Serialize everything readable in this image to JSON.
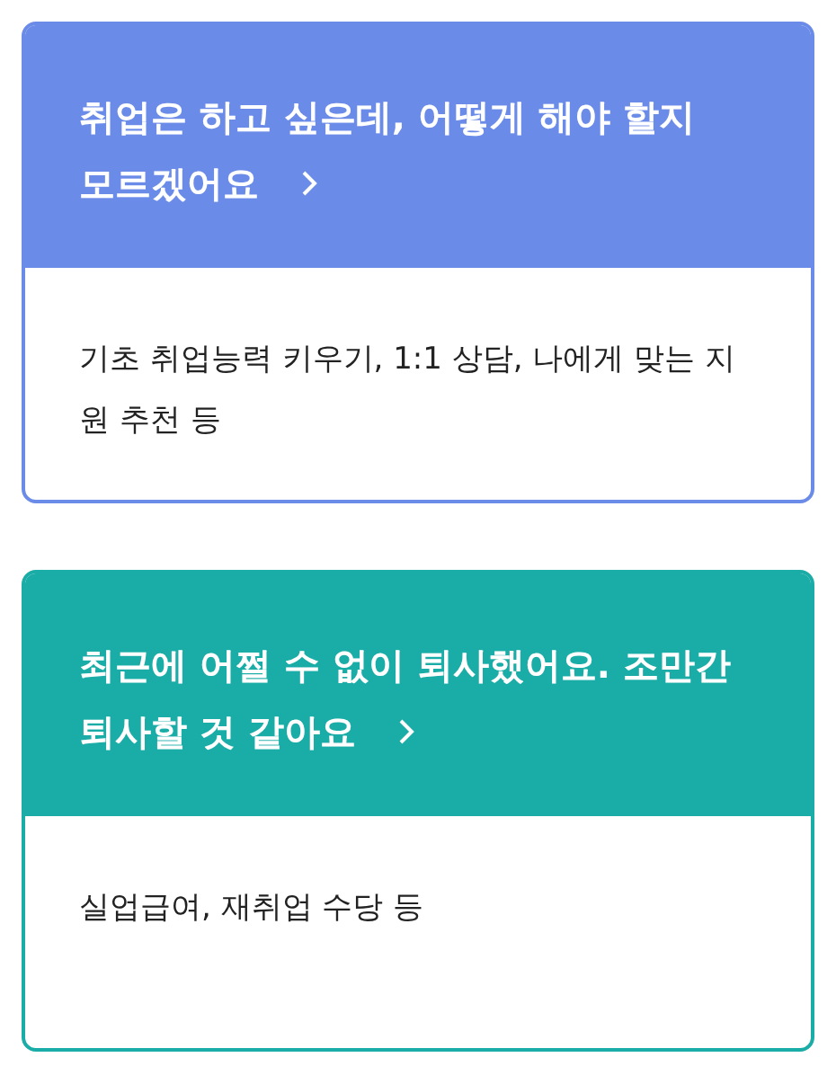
{
  "cards": [
    {
      "title": "취업은 하고 싶은데, 어떻게 해야 할지 모르겠어요",
      "description": "기초 취업능력 키우기, 1:1 상담, 나에게 맞는 지원 추천 등",
      "color": "#6b8be8"
    },
    {
      "title": "최근에 어쩔 수 없이 퇴사했어요. 조만간 퇴사할 것 같아요",
      "description": "실업급여, 재취업 수당 등",
      "color": "#1aaca6"
    }
  ]
}
